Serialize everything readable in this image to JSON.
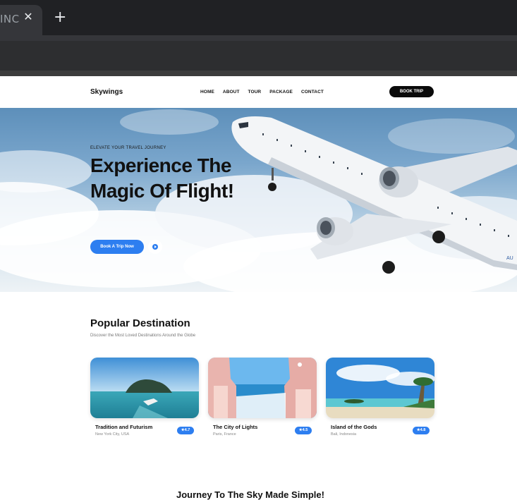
{
  "browser": {
    "tab_title": "INC",
    "close_glyph": "✕",
    "new_tab_glyph": "+"
  },
  "header": {
    "logo": "Skywings",
    "nav": [
      "HOME",
      "ABOUT",
      "TOUR",
      "PACKAGE",
      "CONTACT"
    ],
    "cta": "BOOK TRIP"
  },
  "hero": {
    "eyebrow": "ELEVATE YOUR TRAVEL JOURNEY",
    "title": "Experience The Magic Of Flight!",
    "primary_button": "Book A Trip Now",
    "play_icon": "play-icon",
    "plane_livery": "AU"
  },
  "popular": {
    "title": "Popular Destination",
    "subtitle": "Discover the Most Loved Destinations Around the Globe",
    "cards": [
      {
        "name": "Tradition and Futurism",
        "location": "New York City, USA",
        "rating": "4.7"
      },
      {
        "name": "The City of Lights",
        "location": "Paris, France",
        "rating": "4.5"
      },
      {
        "name": "Island of the Gods",
        "location": "Bali, Indonesia",
        "rating": "4.8"
      }
    ],
    "star_glyph": "★"
  },
  "next_section": {
    "title": "Journey To The Sky Made Simple!"
  },
  "colors": {
    "accent": "#2d7ef0",
    "dark": "#0a0a0a"
  }
}
